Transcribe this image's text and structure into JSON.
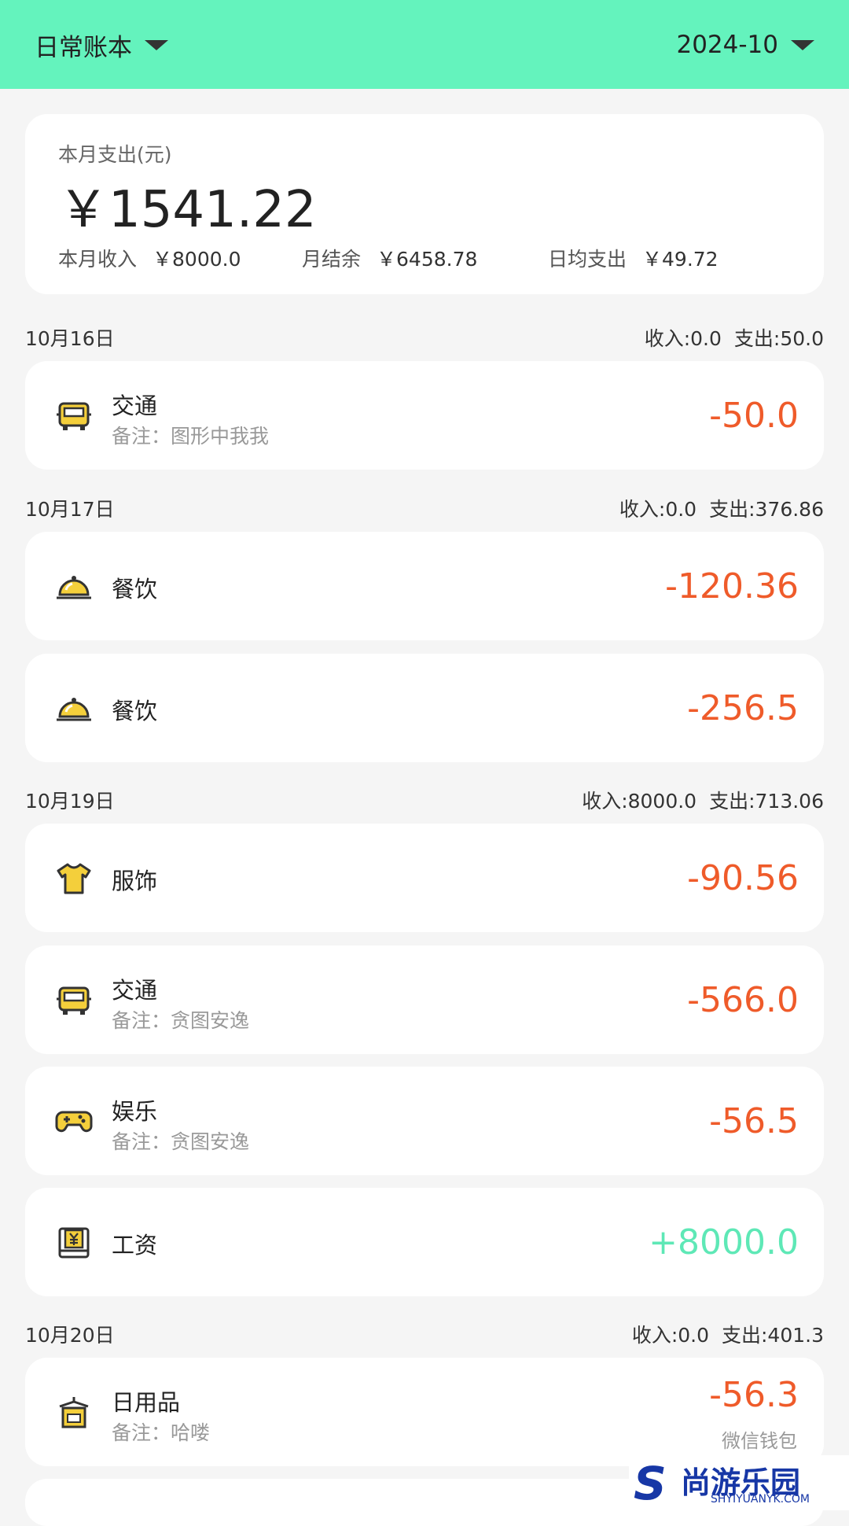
{
  "header": {
    "book_label": "日常账本",
    "month_label": "2024-10",
    "bg_color": "#64f3bd"
  },
  "summary": {
    "expense_label": "本月支出(元)",
    "expense_amount": "￥1541.22",
    "income_label": "本月收入",
    "income_value": "￥8000.0",
    "balance_label": "月结余",
    "balance_value": "￥6458.78",
    "daily_label": "日均支出",
    "daily_value": "￥49.72"
  },
  "days": [
    {
      "date": "10月16日",
      "income": "收入:0.0",
      "expense": "支出:50.0"
    },
    {
      "date": "10月17日",
      "income": "收入:0.0",
      "expense": "支出:376.86"
    },
    {
      "date": "10月19日",
      "income": "收入:8000.0",
      "expense": "支出:713.06"
    },
    {
      "date": "10月20日",
      "income": "收入:0.0",
      "expense": "支出:401.3"
    }
  ],
  "records": [
    {
      "category": "交通",
      "note": "备注：图形中我我",
      "amount": "-50.0",
      "icon": "bus-icon"
    },
    {
      "category": "餐饮",
      "note": "",
      "amount": "-120.36",
      "icon": "food-cloche-icon"
    },
    {
      "category": "餐饮",
      "note": "",
      "amount": "-256.5",
      "icon": "food-cloche-icon"
    },
    {
      "category": "服饰",
      "note": "",
      "amount": "-90.56",
      "icon": "tshirt-icon"
    },
    {
      "category": "交通",
      "note": "备注：贪图安逸",
      "amount": "-566.0",
      "icon": "bus-icon"
    },
    {
      "category": "娱乐",
      "note": "备注：贪图安逸",
      "amount": "-56.5",
      "icon": "gamepad-icon"
    },
    {
      "category": "工资",
      "note": "",
      "amount": "+8000.0",
      "icon": "salary-icon"
    },
    {
      "category": "日用品",
      "note": "备注：哈喽",
      "amount": "-56.3",
      "sub": "微信钱包",
      "icon": "daily-goods-icon"
    }
  ],
  "colors": {
    "expense": "#ef5b2a",
    "income": "#5ee8b6",
    "icon_fill": "#f4cf3b"
  },
  "watermark": {
    "cn": "尚游乐园",
    "en": "SHYIYUANYK.COM"
  }
}
